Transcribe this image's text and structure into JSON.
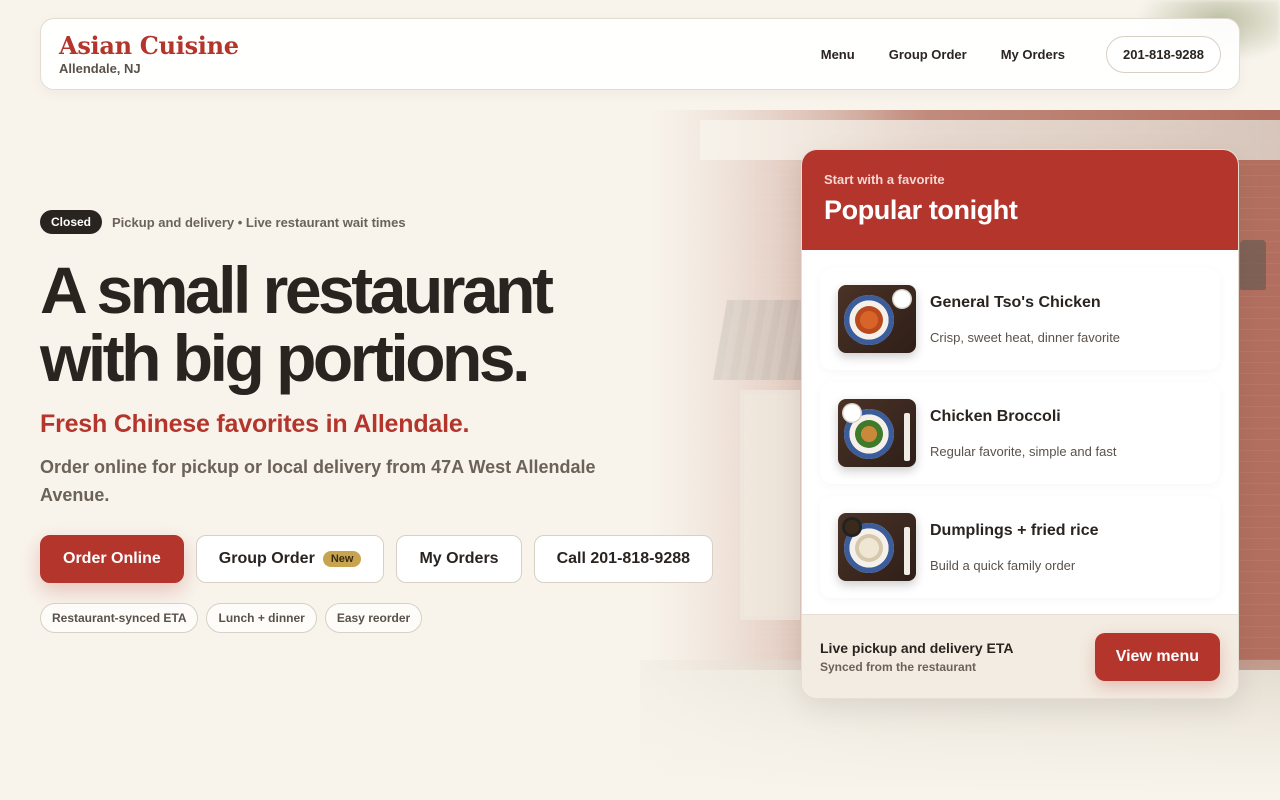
{
  "header": {
    "brand_name": "Asian Cuisine",
    "brand_location": "Allendale, NJ",
    "nav": [
      {
        "label": "Menu"
      },
      {
        "label": "Group Order"
      },
      {
        "label": "My Orders"
      }
    ],
    "phone": "201-818-9288"
  },
  "hero": {
    "status_badge": "Closed",
    "status_note": "Pickup and delivery • Live restaurant wait times",
    "headline": "A small restaurant with big portions.",
    "subhead": "Fresh Chinese favorites in Allendale.",
    "description": "Order online for pickup or local delivery from 47A West Allendale Avenue.",
    "buttons": {
      "order_online": "Order Online",
      "group_order": "Group Order",
      "group_order_badge": "New",
      "my_orders": "My Orders",
      "call": "Call 201-818-9288"
    },
    "chips": [
      "Restaurant-synced ETA",
      "Lunch + dinner",
      "Easy reorder"
    ]
  },
  "popular": {
    "eyebrow": "Start with a favorite",
    "title": "Popular tonight",
    "items": [
      {
        "name": "General Tso's Chicken",
        "description": "Crisp, sweet heat, dinner favorite"
      },
      {
        "name": "Chicken Broccoli",
        "description": "Regular favorite, simple and fast"
      },
      {
        "name": "Dumplings + fried rice",
        "description": "Build a quick family order"
      }
    ],
    "footer_title": "Live pickup and delivery ETA",
    "footer_subtitle": "Synced from the restaurant",
    "view_menu": "View menu"
  },
  "colors": {
    "brand_red": "#b3352c",
    "ink": "#2a2420",
    "muted": "#6b6258",
    "page_bg": "#f8f4ec",
    "badge_gold": "#c9a450"
  }
}
